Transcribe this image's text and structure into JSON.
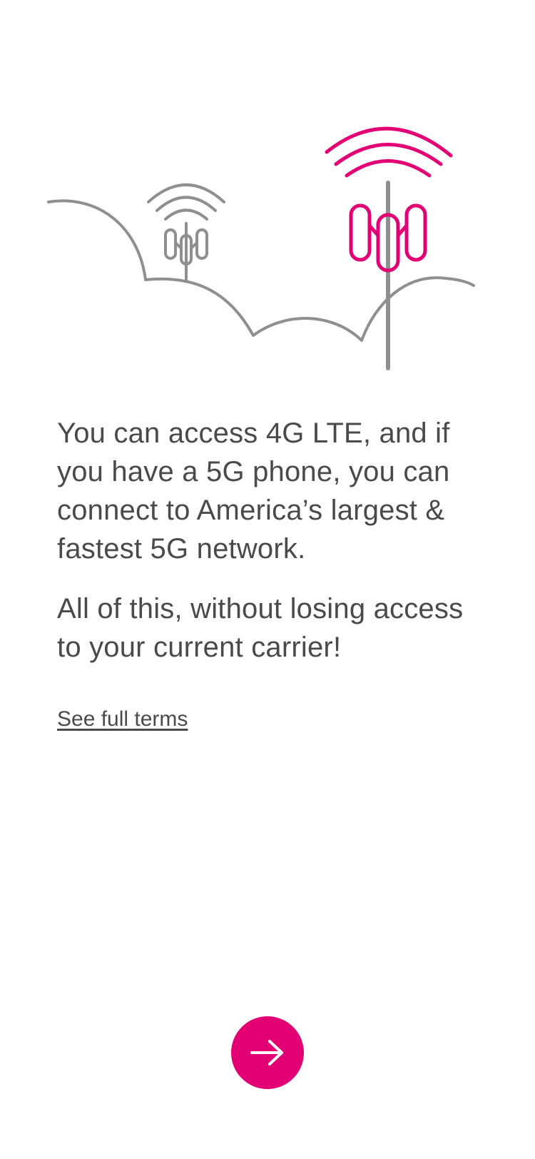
{
  "colors": {
    "brand": "#e20074",
    "text": "#4a4a4a",
    "line": "#8f8f8f",
    "background": "#ffffff"
  },
  "illustration": {
    "left_tower_icon": "small-cell-tower-icon",
    "right_tower_icon": "5g-cell-tower-icon",
    "terrain_icon": "rolling-hills-icon"
  },
  "content": {
    "paragraph_1": "You can access 4G LTE, and if you have a 5G phone, you can connect to America’s largest & fastest 5G network.",
    "paragraph_2": "All of this, without losing access to your current carrier!"
  },
  "links": {
    "terms_label": "See full terms"
  },
  "next_button": {
    "icon": "arrow-right-icon"
  }
}
